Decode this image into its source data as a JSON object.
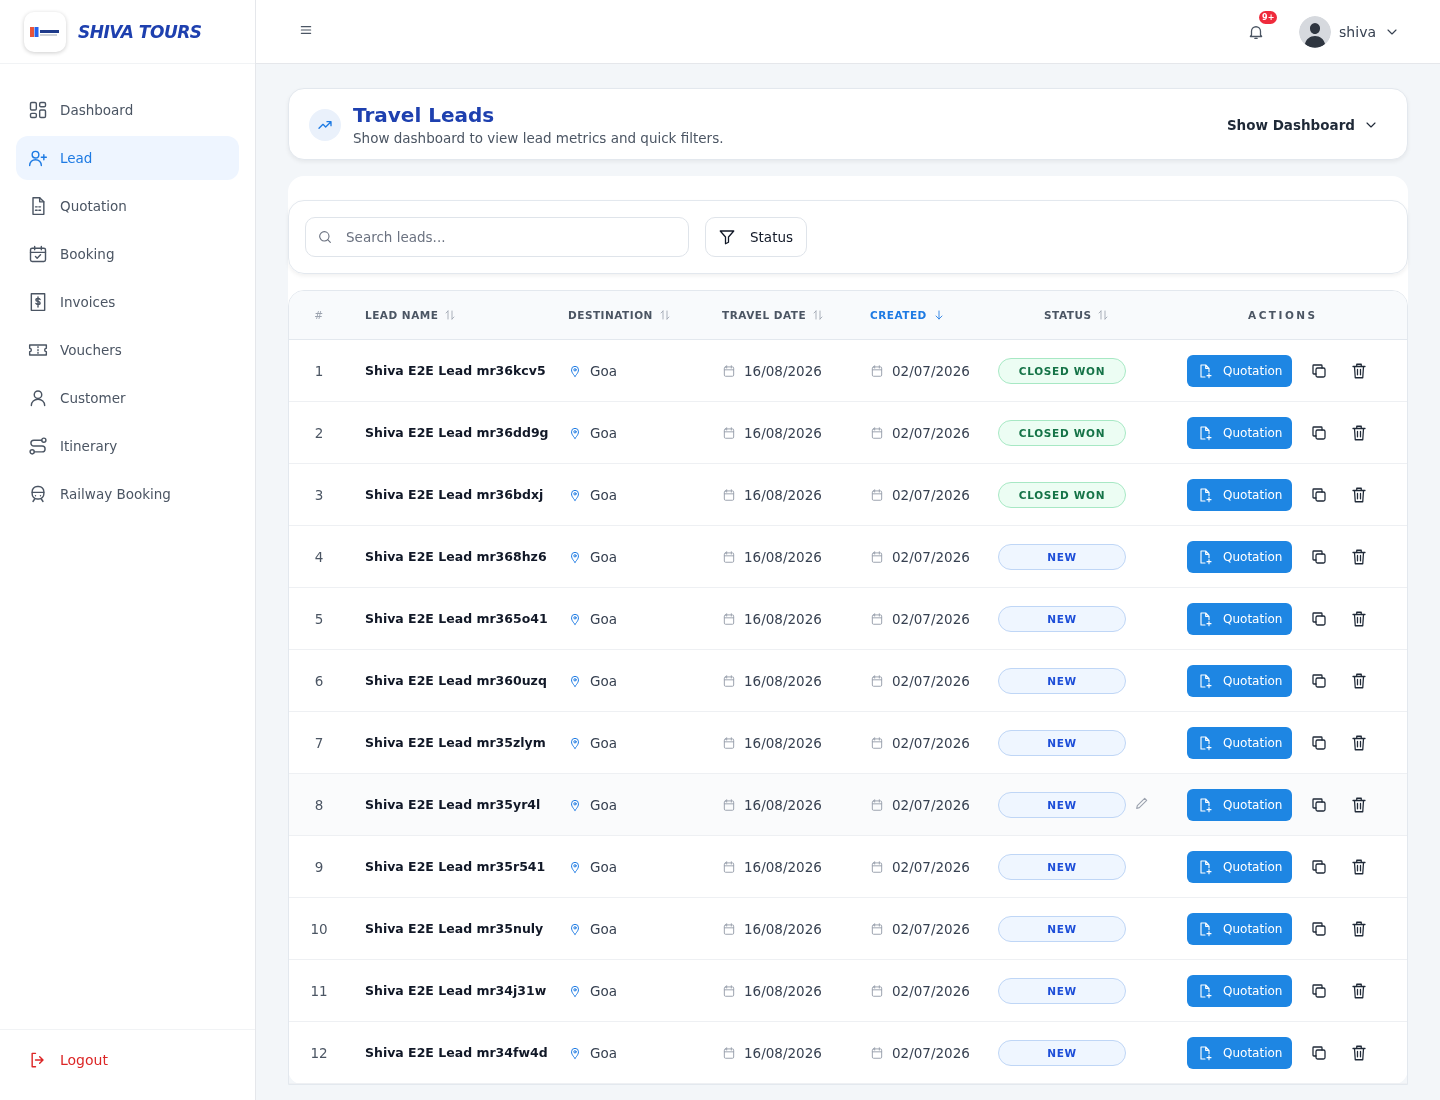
{
  "brand": {
    "name": "SHIVA TOURS"
  },
  "nav": [
    {
      "label": "Dashboard",
      "selected": false
    },
    {
      "label": "Lead",
      "selected": true
    },
    {
      "label": "Quotation",
      "selected": false
    },
    {
      "label": "Booking",
      "selected": false
    },
    {
      "label": "Invoices",
      "selected": false
    },
    {
      "label": "Vouchers",
      "selected": false
    },
    {
      "label": "Customer",
      "selected": false
    },
    {
      "label": "Itinerary",
      "selected": false
    },
    {
      "label": "Railway Booking",
      "selected": false
    }
  ],
  "logout": "Logout",
  "topbar": {
    "notification_count": "9+",
    "user": "shiva"
  },
  "page_header": {
    "title": "Travel Leads",
    "subtitle": "Show dashboard to view lead metrics and quick filters.",
    "toggle": "Show Dashboard"
  },
  "toolbar": {
    "search": {
      "placeholder": "Search leads..."
    },
    "filter": "Status"
  },
  "table": {
    "columns": [
      {
        "label": "#",
        "kind": "plain"
      },
      {
        "label": "LEAD NAME",
        "kind": "sortable",
        "selected": false
      },
      {
        "label": "DESTINATION",
        "kind": "sortable",
        "selected": false
      },
      {
        "label": "TRAVEL DATE",
        "kind": "sortable",
        "selected": false
      },
      {
        "label": "CREATED",
        "kind": "sortable",
        "selected": true
      },
      {
        "label": "STATUS",
        "kind": "sortable",
        "selected": false
      },
      {
        "label": "ACTIONS",
        "kind": "plain"
      }
    ],
    "rows": [
      {
        "index": "1",
        "name": "Shiva E2E Lead mr36kcv5",
        "destination": "Goa",
        "travel_date": "16/08/2026",
        "created": "02/07/2026",
        "status": {
          "label": "CLOSED WON",
          "kind": "won"
        },
        "action": "Quotation",
        "hovered": false
      },
      {
        "index": "2",
        "name": "Shiva E2E Lead mr36dd9g",
        "destination": "Goa",
        "travel_date": "16/08/2026",
        "created": "02/07/2026",
        "status": {
          "label": "CLOSED WON",
          "kind": "won"
        },
        "action": "Quotation",
        "hovered": false
      },
      {
        "index": "3",
        "name": "Shiva E2E Lead mr36bdxj",
        "destination": "Goa",
        "travel_date": "16/08/2026",
        "created": "02/07/2026",
        "status": {
          "label": "CLOSED WON",
          "kind": "won"
        },
        "action": "Quotation",
        "hovered": false
      },
      {
        "index": "4",
        "name": "Shiva E2E Lead mr368hz6",
        "destination": "Goa",
        "travel_date": "16/08/2026",
        "created": "02/07/2026",
        "status": {
          "label": "NEW",
          "kind": "new"
        },
        "action": "Quotation",
        "hovered": false
      },
      {
        "index": "5",
        "name": "Shiva E2E Lead mr365o41",
        "destination": "Goa",
        "travel_date": "16/08/2026",
        "created": "02/07/2026",
        "status": {
          "label": "NEW",
          "kind": "new"
        },
        "action": "Quotation",
        "hovered": false
      },
      {
        "index": "6",
        "name": "Shiva E2E Lead mr360uzq",
        "destination": "Goa",
        "travel_date": "16/08/2026",
        "created": "02/07/2026",
        "status": {
          "label": "NEW",
          "kind": "new"
        },
        "action": "Quotation",
        "hovered": false
      },
      {
        "index": "7",
        "name": "Shiva E2E Lead mr35zlym",
        "destination": "Goa",
        "travel_date": "16/08/2026",
        "created": "02/07/2026",
        "status": {
          "label": "NEW",
          "kind": "new"
        },
        "action": "Quotation",
        "hovered": false
      },
      {
        "index": "8",
        "name": "Shiva E2E Lead mr35yr4l",
        "destination": "Goa",
        "travel_date": "16/08/2026",
        "created": "02/07/2026",
        "status": {
          "label": "NEW",
          "kind": "new"
        },
        "action": "Quotation",
        "hovered": true
      },
      {
        "index": "9",
        "name": "Shiva E2E Lead mr35r541",
        "destination": "Goa",
        "travel_date": "16/08/2026",
        "created": "02/07/2026",
        "status": {
          "label": "NEW",
          "kind": "new"
        },
        "action": "Quotation",
        "hovered": false
      },
      {
        "index": "10",
        "name": "Shiva E2E Lead mr35nuly",
        "destination": "Goa",
        "travel_date": "16/08/2026",
        "created": "02/07/2026",
        "status": {
          "label": "NEW",
          "kind": "new"
        },
        "action": "Quotation",
        "hovered": false
      },
      {
        "index": "11",
        "name": "Shiva E2E Lead mr34j31w",
        "destination": "Goa",
        "travel_date": "16/08/2026",
        "created": "02/07/2026",
        "status": {
          "label": "NEW",
          "kind": "new"
        },
        "action": "Quotation",
        "hovered": false
      },
      {
        "index": "12",
        "name": "Shiva E2E Lead mr34fw4d",
        "destination": "Goa",
        "travel_date": "16/08/2026",
        "created": "02/07/2026",
        "status": {
          "label": "NEW",
          "kind": "new"
        },
        "action": "Quotation",
        "hovered": false
      }
    ]
  }
}
